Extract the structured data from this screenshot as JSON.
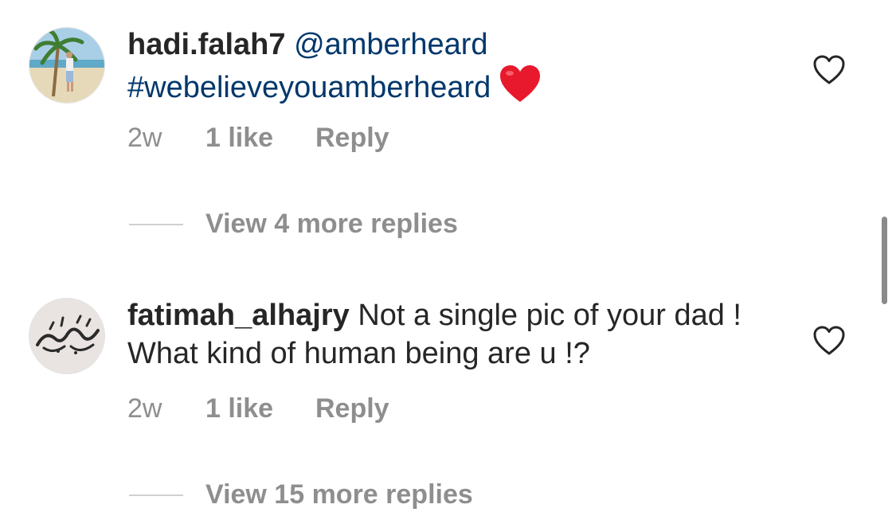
{
  "comments": [
    {
      "username": "hadi.falah7",
      "mention": "@amberheard",
      "hashtag": "#webelieveyouamberheard",
      "emoji": "red-heart",
      "time": "2w",
      "likes": "1 like",
      "reply": "Reply",
      "view_more": "View 4 more replies"
    },
    {
      "username": "fatimah_alhajry",
      "text": "Not a single pic of your dad ! What kind of human being are u !?",
      "time": "2w",
      "likes": "1 like",
      "reply": "Reply",
      "view_more": "View 15 more replies"
    }
  ],
  "colors": {
    "text": "#262626",
    "link": "#00376b",
    "muted": "#8e8e8e",
    "heart_emoji": "#e8192c"
  }
}
